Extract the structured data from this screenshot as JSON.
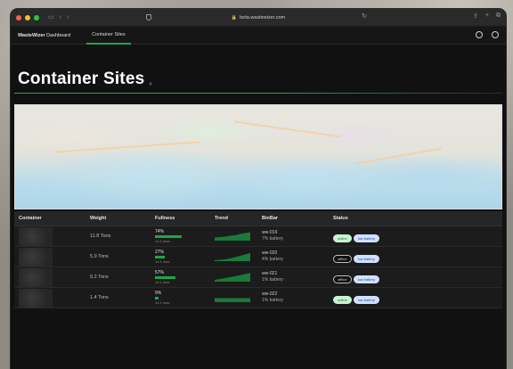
{
  "browser": {
    "url": "beta.wastewizer.com"
  },
  "nav": {
    "brand_bold": "WasteWizer",
    "brand_rest": " Dashboard",
    "tab_label": "Container Sites"
  },
  "page": {
    "title": "Container Sites",
    "count": "4"
  },
  "table": {
    "headers": {
      "container": "Container",
      "weight": "Weight",
      "fullness": "Fullness",
      "trend": "Trend",
      "binbar": "BinBar",
      "status": "Status"
    },
    "rows": [
      {
        "weight": "11.8 Tons",
        "fullness_pct": "74%",
        "fullness_value": 0.74,
        "fullness_max": "1d 1 max",
        "trend": [
          0.35,
          0.4,
          0.45,
          0.55,
          0.6,
          0.75,
          0.85,
          0.95
        ],
        "bin_id": "ww-019",
        "battery": "7% battery",
        "statuses": [
          {
            "label": "online",
            "kind": "online"
          },
          {
            "label": "low battery",
            "kind": "low"
          }
        ]
      },
      {
        "weight": "5.9 Tons",
        "fullness_pct": "27%",
        "fullness_value": 0.27,
        "fullness_max": "1d 1 max",
        "trend": [
          0.1,
          0.15,
          0.2,
          0.3,
          0.45,
          0.6,
          0.75,
          0.9
        ],
        "bin_id": "ww-020",
        "battery": "4% battery",
        "statuses": [
          {
            "label": "offline",
            "kind": "offline"
          },
          {
            "label": "low battery",
            "kind": "low"
          }
        ]
      },
      {
        "weight": "9.2 Tons",
        "fullness_pct": "57%",
        "fullness_value": 0.57,
        "fullness_max": "1d 1 max",
        "trend": [
          0.2,
          0.3,
          0.4,
          0.5,
          0.6,
          0.72,
          0.85,
          0.98
        ],
        "bin_id": "ww-021",
        "battery": "1% battery",
        "statuses": [
          {
            "label": "offline",
            "kind": "offline"
          },
          {
            "label": "low battery",
            "kind": "low"
          }
        ]
      },
      {
        "weight": "1.4 Tons",
        "fullness_pct": "9%",
        "fullness_value": 0.09,
        "fullness_max": "1d 1 max",
        "trend": [
          0.45,
          0.45,
          0.45,
          0.45,
          0.45,
          0.45,
          0.45,
          0.45
        ],
        "bin_id": "ww-022",
        "battery": "1% battery",
        "statuses": [
          {
            "label": "online",
            "kind": "online"
          },
          {
            "label": "low battery",
            "kind": "low"
          }
        ]
      }
    ]
  },
  "colors": {
    "accent": "#1ea54d",
    "online_bg": "#c9f2cf",
    "low_battery_bg": "#cfe1ff"
  }
}
